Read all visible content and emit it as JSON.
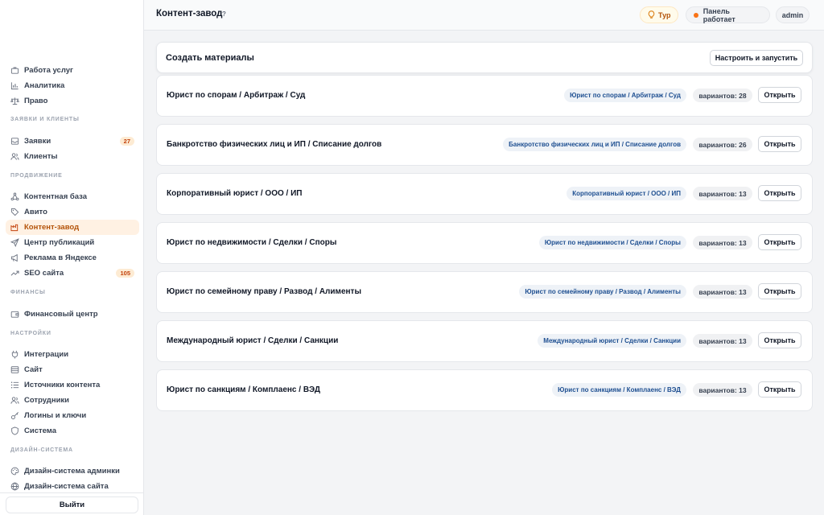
{
  "header": {
    "title": "Контент-завод",
    "help": "?",
    "tour_label": "Тур",
    "status_label": "Панель работает",
    "user_label": "admin"
  },
  "sidebar": {
    "top_items": [
      {
        "label": "Работа услуг",
        "icon": "briefcase-icon"
      },
      {
        "label": "Аналитика",
        "icon": "bar-chart-icon"
      },
      {
        "label": "Право",
        "icon": "scales-icon"
      }
    ],
    "sections": [
      {
        "title": "ЗАЯВКИ И КЛИЕНТЫ",
        "items": [
          {
            "label": "Заявки",
            "icon": "inbox-icon",
            "badge": "27"
          },
          {
            "label": "Клиенты",
            "icon": "users-icon",
            "badge": ""
          }
        ]
      },
      {
        "title": "ПРОДВИЖЕНИЕ",
        "items": [
          {
            "label": "Контентная база",
            "icon": "network-icon",
            "badge": ""
          },
          {
            "label": "Авито",
            "icon": "tag-icon",
            "badge": ""
          },
          {
            "label": "Контент-завод",
            "icon": "factory-icon",
            "badge": "",
            "active": true
          },
          {
            "label": "Центр публикаций",
            "icon": "send-icon",
            "badge": ""
          },
          {
            "label": "Реклама в Яндексе",
            "icon": "megaphone-icon",
            "badge": ""
          },
          {
            "label": "SEO сайта",
            "icon": "trend-icon",
            "badge": "105"
          }
        ]
      },
      {
        "title": "ФИНАНСЫ",
        "items": [
          {
            "label": "Финансовый центр",
            "icon": "wallet-icon",
            "badge": ""
          }
        ]
      },
      {
        "title": "НАСТРОЙКИ",
        "items": [
          {
            "label": "Интеграции",
            "icon": "plug-icon",
            "badge": ""
          },
          {
            "label": "Сайт",
            "icon": "layout-icon",
            "badge": ""
          },
          {
            "label": "Источники контента",
            "icon": "list-icon",
            "badge": ""
          },
          {
            "label": "Сотрудники",
            "icon": "team-icon",
            "badge": ""
          },
          {
            "label": "Логины и ключи",
            "icon": "key-icon",
            "badge": ""
          },
          {
            "label": "Система",
            "icon": "shield-icon",
            "badge": ""
          }
        ]
      },
      {
        "title": "ДИЗАЙН-СИСТЕМА",
        "items": [
          {
            "label": "Дизайн-система админки",
            "icon": "palette-icon",
            "badge": ""
          },
          {
            "label": "Дизайн-система сайта",
            "icon": "globe-icon",
            "badge": ""
          }
        ]
      }
    ],
    "logout_label": "Выйти"
  },
  "main": {
    "create_title": "Создать материалы",
    "create_button": "Настроить и запустить",
    "open_label": "Открыть",
    "rows": [
      {
        "title": "Юрист по спорам / Арбитраж / Суд",
        "tag": "Юрист по спорам / Арбитраж / Суд",
        "count": "вариантов: 28"
      },
      {
        "title": "Банкротство физических лиц и ИП / Списание долгов",
        "tag": "Банкротство физических лиц и ИП / Списание долгов",
        "count": "вариантов: 26"
      },
      {
        "title": "Корпоративный юрист / ООО / ИП",
        "tag": "Корпоративный юрист / ООО / ИП",
        "count": "вариантов: 13"
      },
      {
        "title": "Юрист по недвижимости / Сделки / Споры",
        "tag": "Юрист по недвижимости / Сделки / Споры",
        "count": "вариантов: 13"
      },
      {
        "title": "Юрист по семейному праву / Развод / Алименты",
        "tag": "Юрист по семейному праву / Развод / Алименты",
        "count": "вариантов: 13"
      },
      {
        "title": "Международный юрист / Сделки / Санкции",
        "tag": "Международный юрист / Сделки / Санкции",
        "count": "вариантов: 13"
      },
      {
        "title": "Юрист по санкциям / Комплаенс / ВЭД",
        "tag": "Юрист по санкциям / Комплаенс / ВЭД",
        "count": "вариантов: 13"
      }
    ]
  },
  "colors": {
    "accent": "#f97316",
    "active_bg": "#fff1e3",
    "tag_text": "#1e4f91"
  }
}
